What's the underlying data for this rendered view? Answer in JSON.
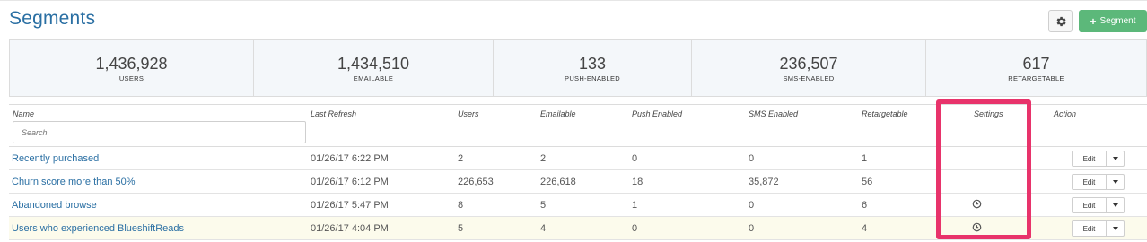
{
  "page": {
    "title": "Segments"
  },
  "toolbar": {
    "add_label": "Segment"
  },
  "stats": [
    {
      "value": "1,436,928",
      "label": "USERS"
    },
    {
      "value": "1,434,510",
      "label": "EMAILABLE"
    },
    {
      "value": "133",
      "label": "PUSH-ENABLED"
    },
    {
      "value": "236,507",
      "label": "SMS-ENABLED"
    },
    {
      "value": "617",
      "label": "RETARGETABLE"
    }
  ],
  "table": {
    "columns": [
      "Name",
      "Last Refresh",
      "Users",
      "Emailable",
      "Push Enabled",
      "SMS Enabled",
      "Retargetable",
      "Settings",
      "Action"
    ],
    "search_placeholder": "Search",
    "edit_label": "Edit",
    "rows": [
      {
        "name": "Recently purchased",
        "last_refresh": "01/26/17 6:22 PM",
        "users": "2",
        "emailable": "2",
        "push": "0",
        "sms": "0",
        "retargetable": "1",
        "settings_icon": ""
      },
      {
        "name": "Churn score more than 50%",
        "last_refresh": "01/26/17 6:12 PM",
        "users": "226,653",
        "emailable": "226,618",
        "push": "18",
        "sms": "35,872",
        "retargetable": "56",
        "settings_icon": ""
      },
      {
        "name": "Abandoned browse",
        "last_refresh": "01/26/17 5:47 PM",
        "users": "8",
        "emailable": "5",
        "push": "1",
        "sms": "0",
        "retargetable": "6",
        "settings_icon": "clock-icon"
      },
      {
        "name": "Users who experienced BlueshiftReads",
        "last_refresh": "01/26/17 4:04 PM",
        "users": "5",
        "emailable": "4",
        "push": "0",
        "sms": "0",
        "retargetable": "4",
        "settings_icon": "clock-icon"
      }
    ]
  },
  "colors": {
    "accent": "#2a6fa3",
    "add_button": "#5cb87a",
    "highlight": "#e8336b",
    "stats_bg": "#f4f7fa"
  }
}
